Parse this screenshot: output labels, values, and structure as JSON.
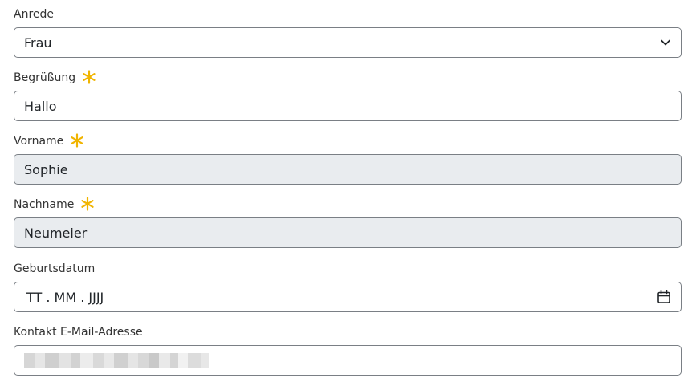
{
  "form": {
    "salutation": {
      "label": "Anrede",
      "value": "Frau",
      "icon": "chevron-down-icon"
    },
    "greeting": {
      "label": "Begrüßung",
      "value": "Hallo",
      "required": true,
      "required_icon": "asterisk-icon"
    },
    "first_name": {
      "label": "Vorname",
      "value": "Sophie",
      "required": true,
      "disabled": true,
      "required_icon": "asterisk-icon"
    },
    "last_name": {
      "label": "Nachname",
      "value": "Neumeier",
      "required": true,
      "disabled": true,
      "required_icon": "asterisk-icon"
    },
    "birth_date": {
      "label": "Geburtsdatum",
      "placeholder": "TT . MM . JJJJ",
      "icon": "calendar-icon"
    },
    "email": {
      "label": "Kontakt E-Mail-Adresse",
      "value_redacted": true
    }
  },
  "colors": {
    "required": "#f0b400",
    "border": "#7a7f85",
    "disabled_bg": "#e9ecef"
  }
}
